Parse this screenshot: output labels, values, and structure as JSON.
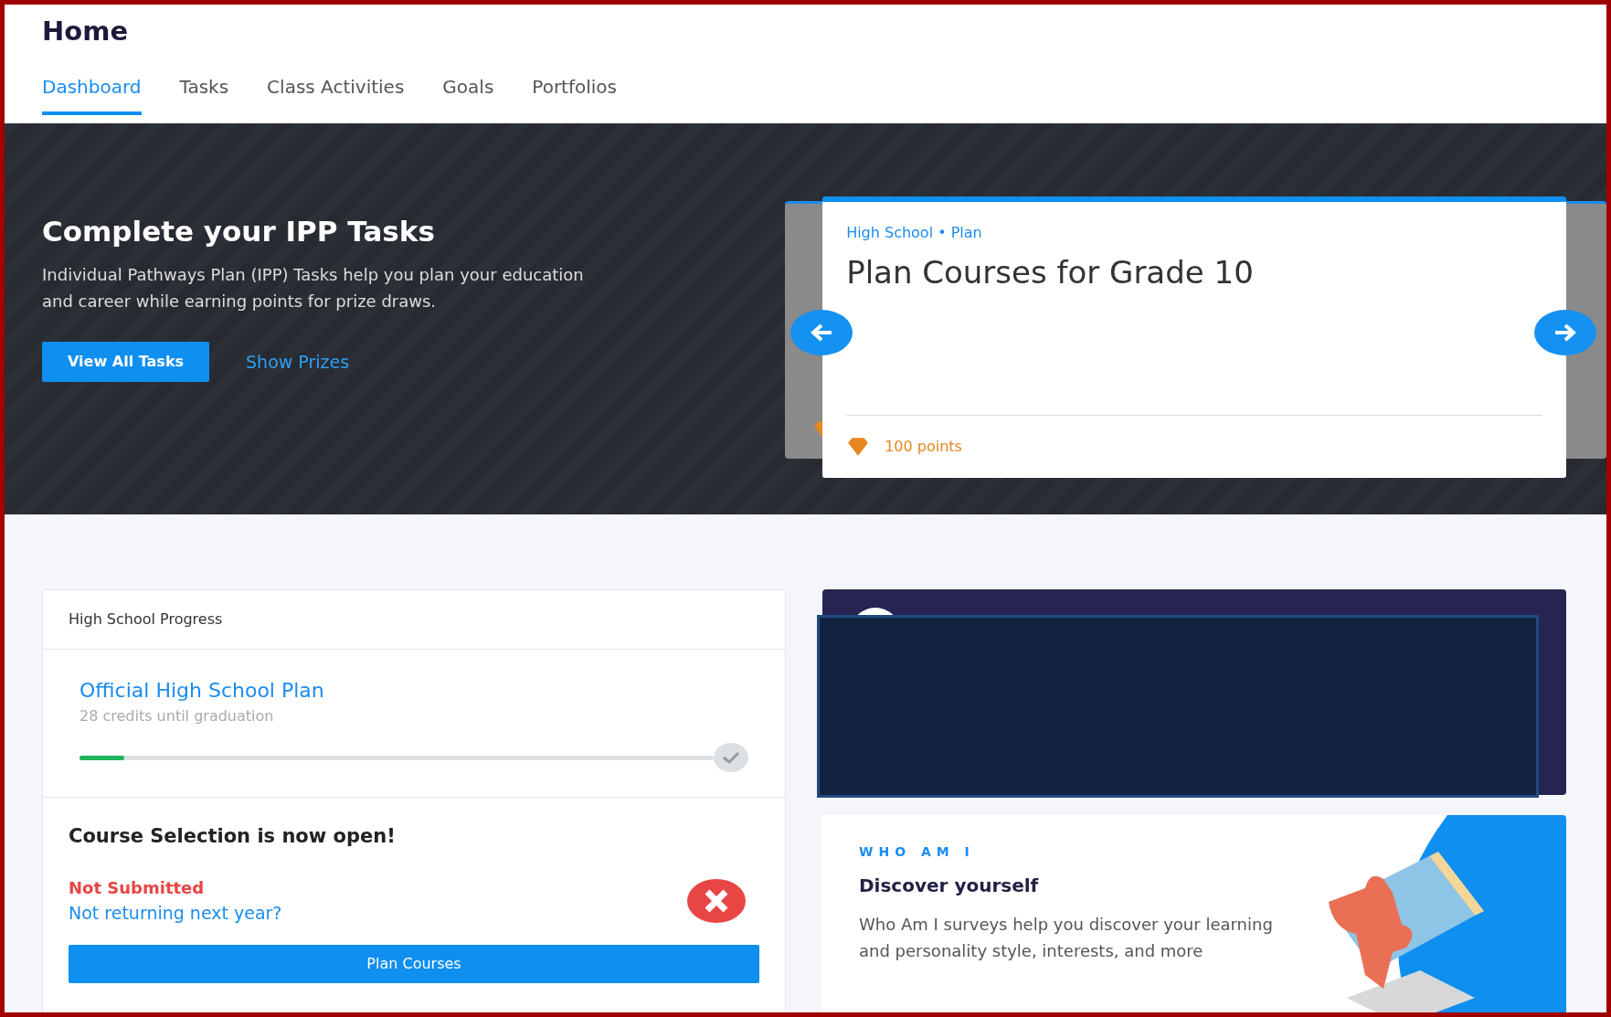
{
  "page": {
    "title": "Home"
  },
  "tabs": [
    {
      "label": "Dashboard",
      "selected": true
    },
    {
      "label": "Tasks",
      "selected": false
    },
    {
      "label": "Class Activities",
      "selected": false
    },
    {
      "label": "Goals",
      "selected": false
    },
    {
      "label": "Portfolios",
      "selected": false
    }
  ],
  "hero": {
    "title": "Complete your IPP Tasks",
    "description": "Individual Pathways Plan (IPP) Tasks help you plan your education and career while earning points for prize draws.",
    "primary_button": "View All Tasks",
    "link": "Show Prizes"
  },
  "carousel": {
    "card": {
      "category": "High School • Plan",
      "title": "Plan Courses for Grade 10",
      "points": "100 points"
    }
  },
  "progress_card": {
    "header": "High School Progress",
    "plan_title": "Official High School Plan",
    "plan_subtitle": "28 credits until graduation",
    "level": 0.07,
    "complete": false,
    "course_title": "Course Selection is now open!",
    "status": "Not Submitted",
    "submitted": false,
    "link": "Not returning next year?",
    "button": "Plan Courses"
  },
  "who_am_i": {
    "eyebrow": "WHO AM I",
    "title": "Discover yourself",
    "description": "Who Am I surveys help you discover your learning and personality style, interests, and more"
  }
}
